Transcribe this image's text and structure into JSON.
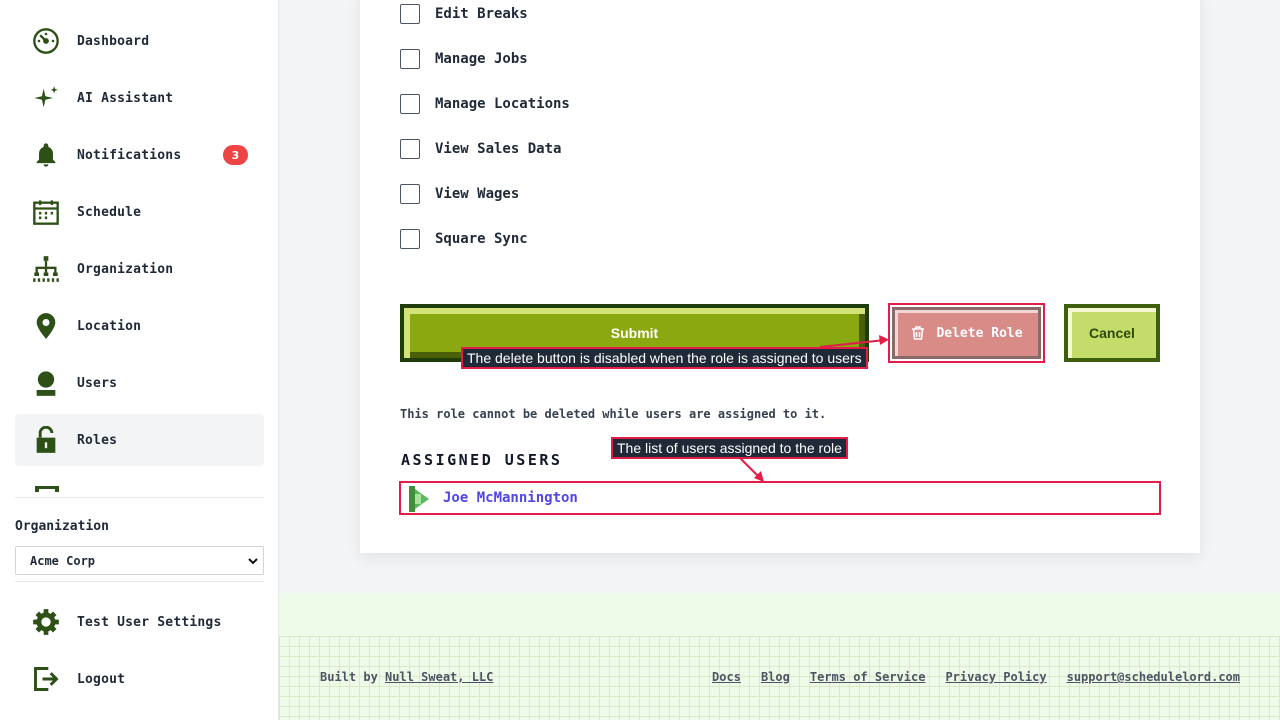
{
  "sidebar": {
    "items": [
      {
        "label": "Dashboard",
        "icon": "dashboard-icon"
      },
      {
        "label": "AI Assistant",
        "icon": "sparkle-icon"
      },
      {
        "label": "Notifications",
        "icon": "bell-icon",
        "badge": "3"
      },
      {
        "label": "Schedule",
        "icon": "calendar-icon"
      },
      {
        "label": "Organization",
        "icon": "org-chart-icon"
      },
      {
        "label": "Location",
        "icon": "map-pin-icon"
      },
      {
        "label": "Users",
        "icon": "user-icon"
      },
      {
        "label": "Roles",
        "icon": "unlock-icon",
        "active": true
      }
    ],
    "organization_label": "Organization",
    "organization_selected": "Acme Corp",
    "bottom_items": [
      {
        "label": "Test User Settings",
        "icon": "gear-icon"
      },
      {
        "label": "Logout",
        "icon": "logout-icon"
      }
    ]
  },
  "permissions": [
    {
      "label": "Edit Breaks",
      "checked": false
    },
    {
      "label": "Manage Jobs",
      "checked": false
    },
    {
      "label": "Manage Locations",
      "checked": false
    },
    {
      "label": "View Sales Data",
      "checked": false
    },
    {
      "label": "View Wages",
      "checked": false
    },
    {
      "label": "Square Sync",
      "checked": false
    }
  ],
  "actions": {
    "submit_label": "Submit",
    "delete_label": "Delete Role",
    "cancel_label": "Cancel"
  },
  "note": "This role cannot be deleted while users are assigned to it.",
  "assigned_users": {
    "heading": "ASSIGNED USERS",
    "users": [
      "Joe McMannington"
    ]
  },
  "callouts": {
    "delete_disabled": "The delete button is disabled when the role is assigned to users",
    "users_list": "The list of users assigned to the role"
  },
  "footer": {
    "built_by_prefix": "Built by",
    "built_by_link": "Null Sweat, LLC",
    "links": [
      "Docs",
      "Blog",
      "Terms of Service",
      "Privacy Policy",
      "support@schedulelord.com"
    ]
  },
  "colors": {
    "brand_green": "#2d5016",
    "submit_green": "#8aa80f",
    "danger": "#e11d48",
    "link": "#4f46e5"
  }
}
